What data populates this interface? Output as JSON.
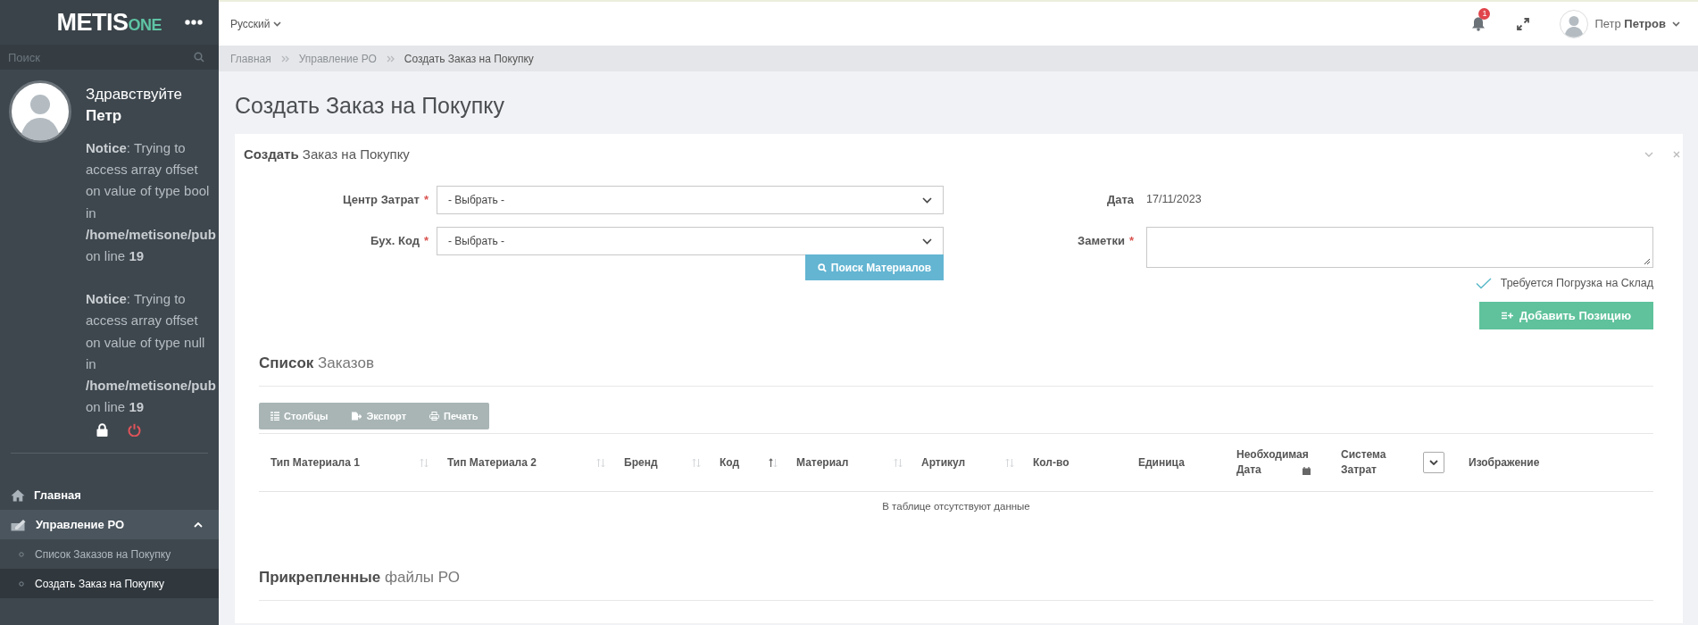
{
  "sidebar": {
    "logo": {
      "main": "METIS",
      "accent": "ONE"
    },
    "search": {
      "placeholder": "Поиск"
    },
    "profile": {
      "greeting": "Здравствуйте",
      "name": "Петр",
      "notices": [
        "**Notice**: Trying to access array offset on value of type bool in **/home/metisone/pub** on line **19**",
        "**Notice**: Trying to access array offset on value of type null in **/home/metisone/pub** on line **19**"
      ]
    },
    "menu": [
      {
        "label": "Главная",
        "selected": false
      },
      {
        "label": "Управление РО",
        "selected": true,
        "expanded": true,
        "children": [
          {
            "label": "Список Заказов на Покупку",
            "selected": false
          },
          {
            "label": "Создать Заказ на Покупку",
            "selected": true
          }
        ]
      }
    ]
  },
  "topbar": {
    "language": "Русский",
    "notifications": "1",
    "user": {
      "first_name": "Петр",
      "last_name": "Петров"
    }
  },
  "breadcrumb": [
    "Главная",
    "Управление РО",
    "Создать Заказ на Покупку"
  ],
  "page_title": "Создать Заказ на Покупку",
  "card": {
    "title": "**Создать** Заказ на Покупку",
    "left_fields": [
      {
        "label": "Центр Затрат",
        "required_mark": "*",
        "kind": "select",
        "value": "- Выбрать -"
      },
      {
        "label": "Бух. Код",
        "required_mark": "*",
        "kind": "select",
        "value": "- Выбрать -"
      }
    ],
    "search_button": "Поиск Материалов",
    "right_fields": [
      {
        "label": "Дата",
        "kind": "text",
        "value": "17/11/2023"
      },
      {
        "label": "Заметки",
        "required_mark": "*",
        "kind": "textarea"
      }
    ],
    "checkbox": {
      "label": "Требуется Погрузка на Склад",
      "checked": true
    },
    "add_button": "Добавить Позицию",
    "orders": {
      "title": "**Список** Заказов",
      "toolbar": [
        {
          "label": "Столбцы"
        },
        {
          "label": "Экспорт"
        },
        {
          "label": "Печать"
        }
      ],
      "columns": [
        {
          "kind": "text",
          "label": "Тип Материала 1",
          "sortable": true,
          "sorted": false
        },
        {
          "kind": "text",
          "label": "Тип Материала 2",
          "sortable": true,
          "sorted": false
        },
        {
          "kind": "text",
          "label": "Бренд",
          "sortable": true,
          "sorted": false
        },
        {
          "kind": "text",
          "label": "Код",
          "sortable": true,
          "sorted": true
        },
        {
          "kind": "text",
          "label": "Материал",
          "sortable": true,
          "sorted": false
        },
        {
          "kind": "text",
          "label": "Артикул",
          "sortable": true,
          "sorted": false
        },
        {
          "kind": "text",
          "label": "Кол-во"
        },
        {
          "kind": "text",
          "label": "Единица"
        },
        {
          "kind": "date",
          "label": "Необходимая Дата"
        },
        {
          "kind": "text",
          "label": "Система Затрат"
        },
        {
          "kind": "toggle"
        },
        {
          "kind": "text",
          "label": "Изображение"
        }
      ],
      "empty_message": "В таблице отсутствуют данные"
    },
    "attachments_title": "**Прикрепленные** файлы РО"
  }
}
